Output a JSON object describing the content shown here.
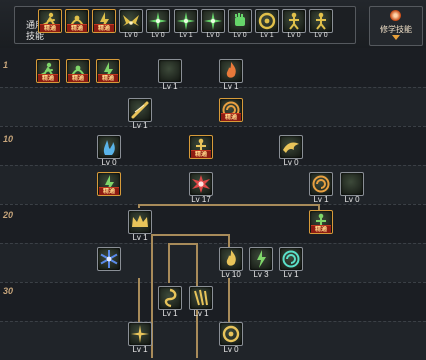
{
  "header": {
    "common_label": "通用\n技能",
    "rune_label": "修学技能",
    "rune_icon": "orb-icon",
    "slots": [
      {
        "icon": "runner-icon",
        "state": "mastered",
        "badge": "精通",
        "tint": "#e0c04a"
      },
      {
        "icon": "leap-icon",
        "state": "mastered",
        "badge": "精通",
        "tint": "#e0c04a"
      },
      {
        "icon": "lightning-fist-icon",
        "state": "mastered",
        "badge": "精通",
        "tint": "#e0c04a"
      },
      {
        "icon": "wings-icon",
        "state": "level",
        "level": "Lv 0",
        "tint": "#e0c04a"
      },
      {
        "icon": "starburst-icon",
        "state": "level",
        "level": "Lv 0",
        "tint": "#66d66a"
      },
      {
        "icon": "starburst-icon",
        "state": "level",
        "level": "Lv 1",
        "tint": "#66d66a"
      },
      {
        "icon": "starburst-icon",
        "state": "level",
        "level": "Lv 0",
        "tint": "#66d66a"
      },
      {
        "icon": "fist-icon",
        "state": "level",
        "level": "Lv 0",
        "tint": "#66d66a"
      },
      {
        "icon": "ring-icon",
        "state": "level",
        "level": "Lv 1",
        "tint": "#e0c04a"
      },
      {
        "icon": "figure-icon",
        "state": "level",
        "level": "Lv 0",
        "tint": "#e0c04a"
      },
      {
        "icon": "figure-icon",
        "state": "level",
        "level": "Lv 0",
        "tint": "#e0c04a"
      }
    ]
  },
  "level_markers": [
    "1",
    "10",
    "20",
    "30"
  ],
  "tree_skills": [
    {
      "icon": "runner-icon",
      "state": "mastered",
      "badge": "精通",
      "tint": "#7fd66a"
    },
    {
      "icon": "leap-icon",
      "state": "mastered",
      "badge": "精通",
      "tint": "#7fd66a"
    },
    {
      "icon": "lightning-fist-icon",
      "state": "mastered",
      "badge": "精通",
      "tint": "#7fd66a"
    },
    {
      "icon": "crescent-icon",
      "state": "level",
      "level": "Lv 1",
      "tint": "#e8c45a"
    },
    {
      "icon": "flame-icon",
      "state": "level",
      "level": "Lv 1",
      "tint": "#e87a3a"
    },
    {
      "icon": "slash-icon",
      "state": "level",
      "level": "Lv 1",
      "tint": "#e8c45a"
    },
    {
      "icon": "vortex-icon",
      "state": "mastered",
      "badge": "精通",
      "tint": "#e8a040"
    },
    {
      "icon": "spirit-icon",
      "state": "level",
      "level": "Lv 0",
      "tint": "#5ab4e8"
    },
    {
      "icon": "figure-icon",
      "state": "mastered",
      "badge": "精通",
      "tint": "#e8c45a"
    },
    {
      "icon": "dragon-icon",
      "state": "level",
      "level": "Lv 0",
      "tint": "#e8c45a"
    },
    {
      "icon": "lightning-fist-icon",
      "state": "mastered",
      "badge": "精通",
      "tint": "#7fd66a"
    },
    {
      "icon": "crimson-burst-icon",
      "state": "level",
      "level": "Lv 17",
      "tint": "#e04848"
    },
    {
      "icon": "vortex-icon",
      "state": "level",
      "level": "Lv 1",
      "tint": "#e8a040"
    },
    {
      "icon": "crescent-icon",
      "state": "level",
      "level": "Lv 0",
      "tint": "#e8c45a"
    },
    {
      "icon": "crown-icon",
      "state": "level",
      "level": "Lv 1",
      "tint": "#e8c45a"
    },
    {
      "icon": "figure-icon",
      "state": "mastered",
      "badge": "精通",
      "tint": "#7fd66a"
    },
    {
      "icon": "frost-star-icon",
      "state": "level",
      "level": "",
      "tint": "#5a8ae8"
    },
    {
      "icon": "flame-icon",
      "state": "level",
      "level": "Lv 10",
      "tint": "#e8c45a"
    },
    {
      "icon": "lightning-fist-icon",
      "state": "level",
      "level": "Lv 3",
      "tint": "#7fd66a"
    },
    {
      "icon": "vortex-icon",
      "state": "level",
      "level": "Lv 1",
      "tint": "#5ae0c8"
    },
    {
      "icon": "whirl-icon",
      "state": "level",
      "level": "Lv 1",
      "tint": "#e8c45a"
    },
    {
      "icon": "blade-rain-icon",
      "state": "level",
      "level": "Lv 1",
      "tint": "#e8c45a"
    },
    {
      "icon": "spark-icon",
      "state": "level",
      "level": "Lv 1",
      "tint": "#e8c45a"
    },
    {
      "icon": "ring-icon",
      "state": "level",
      "level": "Lv 0",
      "tint": "#e8c45a"
    }
  ]
}
